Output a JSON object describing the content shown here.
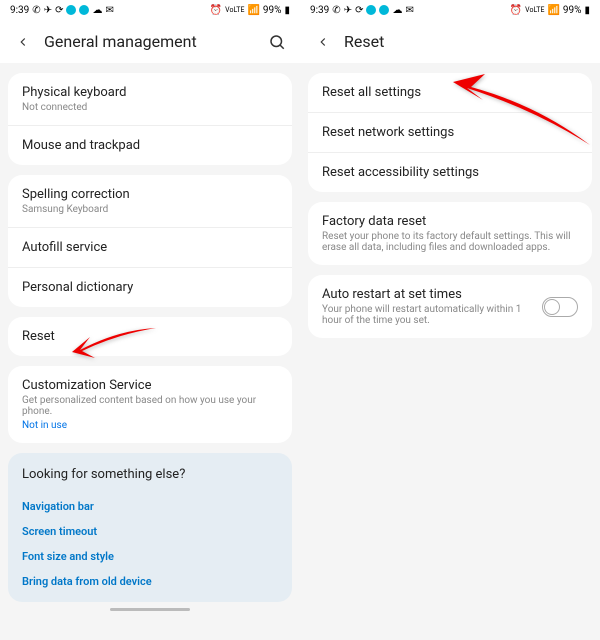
{
  "status": {
    "time": "9:39",
    "battery": "99%"
  },
  "left": {
    "title": "General management",
    "g1": {
      "item1": {
        "title": "Physical keyboard",
        "sub": "Not connected"
      },
      "item2": {
        "title": "Mouse and trackpad"
      }
    },
    "g2": {
      "item1": {
        "title": "Spelling correction",
        "sub": "Samsung Keyboard"
      },
      "item2": {
        "title": "Autofill service"
      },
      "item3": {
        "title": "Personal dictionary"
      }
    },
    "g3": {
      "item1": {
        "title": "Reset"
      }
    },
    "g4": {
      "item1": {
        "title": "Customization Service",
        "sub": "Get personalized content based on how you use your phone.",
        "link": "Not in use"
      }
    },
    "footer": {
      "heading": "Looking for something else?",
      "l1": "Navigation bar",
      "l2": "Screen timeout",
      "l3": "Font size and style",
      "l4": "Bring data from old device"
    }
  },
  "right": {
    "title": "Reset",
    "g1": {
      "item1": {
        "title": "Reset all settings"
      },
      "item2": {
        "title": "Reset network settings"
      },
      "item3": {
        "title": "Reset accessibility settings"
      }
    },
    "g2": {
      "item1": {
        "title": "Factory data reset",
        "sub": "Reset your phone to its factory default settings. This will erase all data, including files and downloaded apps."
      }
    },
    "g3": {
      "item1": {
        "title": "Auto restart at set times",
        "sub": "Your phone will restart automatically within 1 hour of the time you set."
      }
    }
  }
}
